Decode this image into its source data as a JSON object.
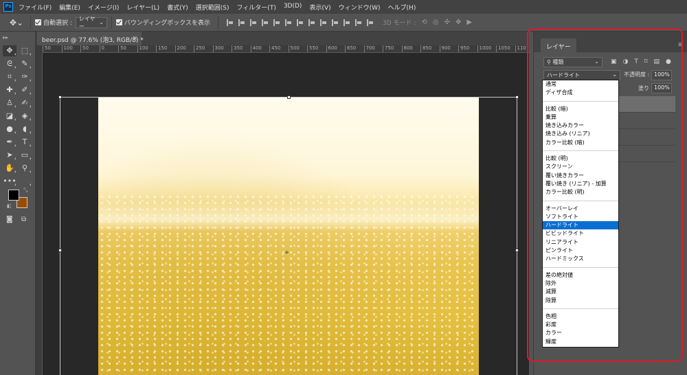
{
  "menubar": {
    "app_logo": "Ps",
    "items": [
      "ファイル(F)",
      "編集(E)",
      "イメージ(I)",
      "レイヤー(L)",
      "書式(Y)",
      "選択範囲(S)",
      "フィルター(T)",
      "3D(D)",
      "表示(V)",
      "ウィンドウ(W)",
      "ヘルプ(H)"
    ]
  },
  "options": {
    "auto_select_label": "自動選択 :",
    "auto_select_value": "レイヤー",
    "transform_label": "バウンディングボックスを表示",
    "mode_3d_label": "3D モード :"
  },
  "document": {
    "tab_title": "beer.psd @ 77.6% (泡3, RGB/8) *",
    "close_glyph": "×"
  },
  "ruler": {
    "ticks": [
      "50",
      "100",
      "50",
      "0",
      "50",
      "100",
      "150",
      "200",
      "250",
      "300",
      "350",
      "400",
      "450",
      "500",
      "550",
      "600",
      "650",
      "700",
      "750",
      "800",
      "850",
      "900",
      "950",
      "1000",
      "1050",
      "110"
    ]
  },
  "layers_panel": {
    "title": "レイヤー",
    "filter_label": "種類",
    "blend_mode": "ハードライト",
    "opacity_label": "不透明度 :",
    "opacity_value": "100%",
    "fill_label": "塗り :",
    "fill_value": "100%"
  },
  "blend_menu": {
    "selected": "ハードライト",
    "groups": [
      [
        "通常",
        "ディザ合成"
      ],
      [
        "比較 (暗)",
        "乗算",
        "焼き込みカラー",
        "焼き込み (リニア)",
        "カラー比較 (暗)"
      ],
      [
        "比較 (明)",
        "スクリーン",
        "覆い焼きカラー",
        "覆い焼き (リニア) - 加算",
        "カラー比較 (明)"
      ],
      [
        "オーバーレイ",
        "ソフトライト",
        "ハードライト",
        "ビビッドライト",
        "リニアライト",
        "ピンライト",
        "ハードミックス"
      ],
      [
        "差の絶対値",
        "除外",
        "減算",
        "除算"
      ],
      [
        "色相",
        "彩度",
        "カラー",
        "輝度"
      ]
    ]
  },
  "colors": {
    "foreground": "#000000",
    "background": "#9a4d00",
    "highlight": "#e0182d",
    "selection": "#0a6ed1"
  },
  "icons": {
    "move_tool": "move-icon",
    "search": "search-icon",
    "panel_menu": "hamburger-icon"
  }
}
